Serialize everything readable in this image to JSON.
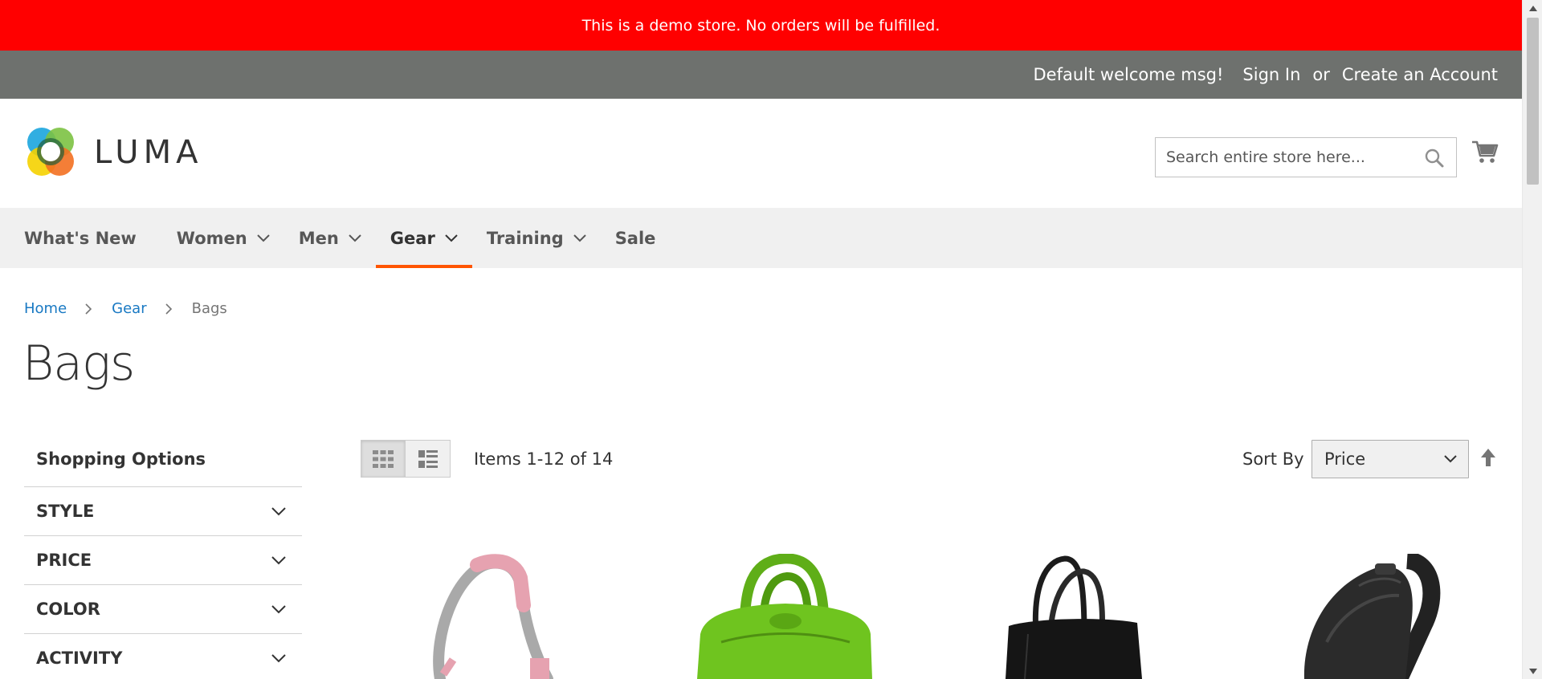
{
  "demo_notice": "This is a demo store. No orders will be fulfilled.",
  "top_panel": {
    "welcome": "Default welcome msg!",
    "sign_in": "Sign In",
    "or": "or",
    "create_account": "Create an Account"
  },
  "header": {
    "logo_text": "LUMA",
    "search_placeholder": "Search entire store here...",
    "search_value": ""
  },
  "nav": {
    "items": [
      {
        "label": "What's New",
        "has_dropdown": false
      },
      {
        "label": "Women",
        "has_dropdown": true
      },
      {
        "label": "Men",
        "has_dropdown": true
      },
      {
        "label": "Gear",
        "has_dropdown": true,
        "active": true
      },
      {
        "label": "Training",
        "has_dropdown": true
      },
      {
        "label": "Sale",
        "has_dropdown": false
      }
    ]
  },
  "breadcrumbs": [
    {
      "label": "Home",
      "link": true
    },
    {
      "label": "Gear",
      "link": true
    },
    {
      "label": "Bags",
      "link": false
    }
  ],
  "page_title": "Bags",
  "sidebar": {
    "title": "Shopping Options",
    "filters": [
      "STYLE",
      "PRICE",
      "COLOR",
      "ACTIVITY"
    ]
  },
  "toolbar": {
    "view_modes": [
      {
        "name": "grid",
        "active": true
      },
      {
        "name": "list",
        "active": false
      }
    ],
    "amount": "Items 1-12 of 14",
    "sort_label": "Sort By",
    "sort_value": "Price"
  },
  "products": [
    {
      "image": "pink-gray-shoulder-strap-bag"
    },
    {
      "image": "green-duffle-bag"
    },
    {
      "image": "black-tote-bag"
    },
    {
      "image": "black-sling-backpack"
    }
  ],
  "colors": {
    "demo_bar": "#ff0000",
    "top_panel": "#6e716e",
    "nav_bg": "#f0f0f0",
    "nav_active_underline": "#ff5501",
    "link": "#1979c3"
  }
}
